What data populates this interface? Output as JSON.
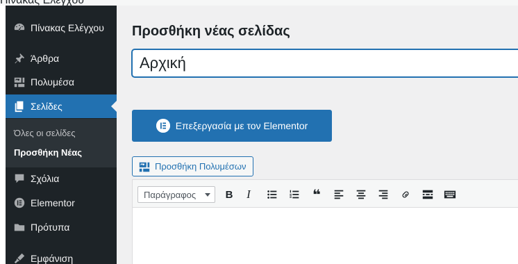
{
  "top_strip_text": "Πίνακας Ελέγχου",
  "sidebar": {
    "items": [
      {
        "label": "Πίνακας Ελέγχου",
        "icon": "dashboard-icon"
      },
      {
        "label": "Άρθρα",
        "icon": "pin-icon"
      },
      {
        "label": "Πολυμέσα",
        "icon": "media-icon"
      },
      {
        "label": "Σελίδες",
        "icon": "pages-icon",
        "active": true
      },
      {
        "label": "Σχόλια",
        "icon": "comments-icon"
      },
      {
        "label": "Elementor",
        "icon": "elementor-icon"
      },
      {
        "label": "Πρότυπα",
        "icon": "folder-icon"
      },
      {
        "label": "Εμφάνιση",
        "icon": "appearance-icon"
      }
    ],
    "submenu": [
      {
        "label": "Όλες οι σελίδες"
      },
      {
        "label": "Προσθήκη Νέας",
        "current": true
      }
    ]
  },
  "main": {
    "page_title": "Προσθήκη νέας σελίδας",
    "title_value": "Αρχική",
    "elementor_button": "Επεξεργασία με τον Elementor",
    "add_media_button": "Προσθήκη Πολυμέσων"
  },
  "editor": {
    "format_select": "Παράγραφος",
    "toolbar_buttons": [
      "bold",
      "italic",
      "bulleted-list",
      "numbered-list",
      "blockquote",
      "align-left",
      "align-center",
      "align-right",
      "link",
      "read-more",
      "toolbar-toggle"
    ],
    "bold_glyph": "B",
    "italic_glyph": "I",
    "quote_glyph": "❝"
  },
  "colors": {
    "sidebar_bg": "#1d2327",
    "accent": "#2271b1",
    "page_bg": "#f0f0f1"
  }
}
